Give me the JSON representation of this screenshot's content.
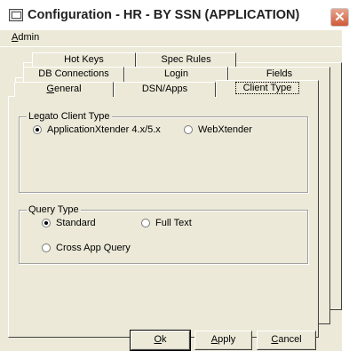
{
  "window": {
    "title": "Configuration - HR - BY SSN (APPLICATION)"
  },
  "menu": {
    "items": [
      {
        "label": "Admin"
      }
    ]
  },
  "tabs": {
    "row1": [
      {
        "label": "Hot Keys"
      },
      {
        "label": "Spec Rules"
      }
    ],
    "row2": [
      {
        "label": "DB Connections"
      },
      {
        "label": "Login"
      },
      {
        "label": "Fields"
      }
    ],
    "row3": [
      {
        "label": "General"
      },
      {
        "label": "DSN/Apps"
      },
      {
        "label": "Client Type"
      }
    ],
    "active": "Client Type"
  },
  "legato_group": {
    "label": "Legato Client Type",
    "options": [
      {
        "label": "ApplicationXtender 4.x/5.x",
        "selected": true
      },
      {
        "label": "WebXtender",
        "selected": false
      }
    ]
  },
  "query_group": {
    "label": "Query Type",
    "options": [
      {
        "label": "Standard",
        "selected": true
      },
      {
        "label": "Full Text",
        "selected": false
      },
      {
        "label": "Cross App Query",
        "selected": false
      }
    ]
  },
  "buttons": {
    "ok": "Ok",
    "apply": "Apply",
    "cancel": "Cancel"
  }
}
